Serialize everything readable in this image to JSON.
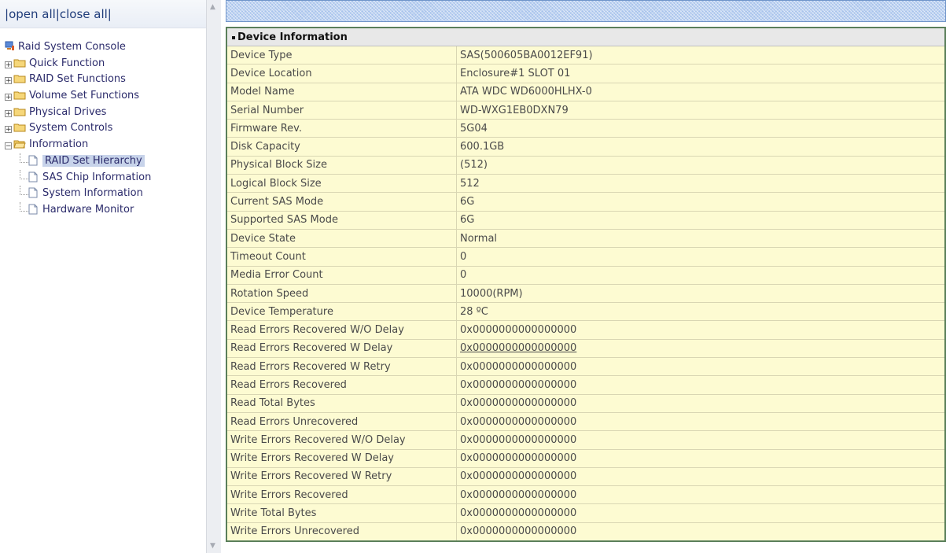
{
  "left_frame": {
    "open_close": {
      "sep1": "|",
      "open": "open all",
      "sep2": "|",
      "close": "close all",
      "sep3": "|"
    },
    "tree": {
      "root": "Raid System Console",
      "folders": [
        "Quick Function",
        "RAID Set Functions",
        "Volume Set Functions",
        "Physical Drives",
        "System Controls"
      ],
      "open_folder": "Information",
      "leaves": [
        "RAID Set Hierarchy",
        "SAS Chip Information",
        "System Information",
        "Hardware Monitor"
      ],
      "selected_leaf": "RAID Set Hierarchy"
    }
  },
  "device_info": {
    "header": "Device Information",
    "rows": [
      {
        "key": "Device Type",
        "value": "SAS(500605BA0012EF91)"
      },
      {
        "key": "Device Location",
        "value": "Enclosure#1 SLOT 01"
      },
      {
        "key": "Model Name",
        "value": "ATA WDC WD6000HLHX-0"
      },
      {
        "key": "Serial Number",
        "value": "WD-WXG1EB0DXN79"
      },
      {
        "key": "Firmware Rev.",
        "value": "5G04"
      },
      {
        "key": "Disk Capacity",
        "value": "600.1GB"
      },
      {
        "key": "Physical Block Size",
        "value": "(512)"
      },
      {
        "key": "Logical Block Size",
        "value": "512"
      },
      {
        "key": "Current SAS Mode",
        "value": "6G"
      },
      {
        "key": "Supported SAS Mode",
        "value": "6G"
      },
      {
        "key": "Device State",
        "value": "Normal"
      },
      {
        "key": "Timeout Count",
        "value": "0"
      },
      {
        "key": "Media Error Count",
        "value": "0"
      },
      {
        "key": "Rotation Speed",
        "value": "10000(RPM)"
      },
      {
        "key": "Device Temperature",
        "value": "28 ºC"
      },
      {
        "key": "Read Errors Recovered W/O Delay",
        "value": "0x0000000000000000"
      },
      {
        "key": "Read Errors Recovered W Delay",
        "value": "0x0000000000000000"
      },
      {
        "key": "Read Errors Recovered W Retry",
        "value": "0x0000000000000000"
      },
      {
        "key": "Read Errors Recovered",
        "value": "0x0000000000000000"
      },
      {
        "key": "Read Total Bytes",
        "value": "0x0000000000000000"
      },
      {
        "key": "Read Errors Unrecovered",
        "value": "0x0000000000000000"
      },
      {
        "key": "Write Errors Recovered W/O Delay",
        "value": "0x0000000000000000"
      },
      {
        "key": "Write Errors Recovered W Delay",
        "value": "0x0000000000000000"
      },
      {
        "key": "Write Errors Recovered W Retry",
        "value": "0x0000000000000000"
      },
      {
        "key": "Write Errors Recovered",
        "value": "0x0000000000000000"
      },
      {
        "key": "Write Total Bytes",
        "value": "0x0000000000000000"
      },
      {
        "key": "Write Errors Unrecovered",
        "value": "0x0000000000000000"
      }
    ]
  },
  "colors": {
    "row_background": "#fdfbd2",
    "header_background": "#e8e8e8",
    "banner": "#a9c4ec",
    "selected_leaf": "#c7d3ea"
  },
  "icons": {
    "root": "computer-icon",
    "folder_closed": "folder-icon",
    "folder_open": "folder-open-icon",
    "leaf": "document-icon",
    "expand": "plus-icon",
    "collapse": "minus-icon"
  }
}
